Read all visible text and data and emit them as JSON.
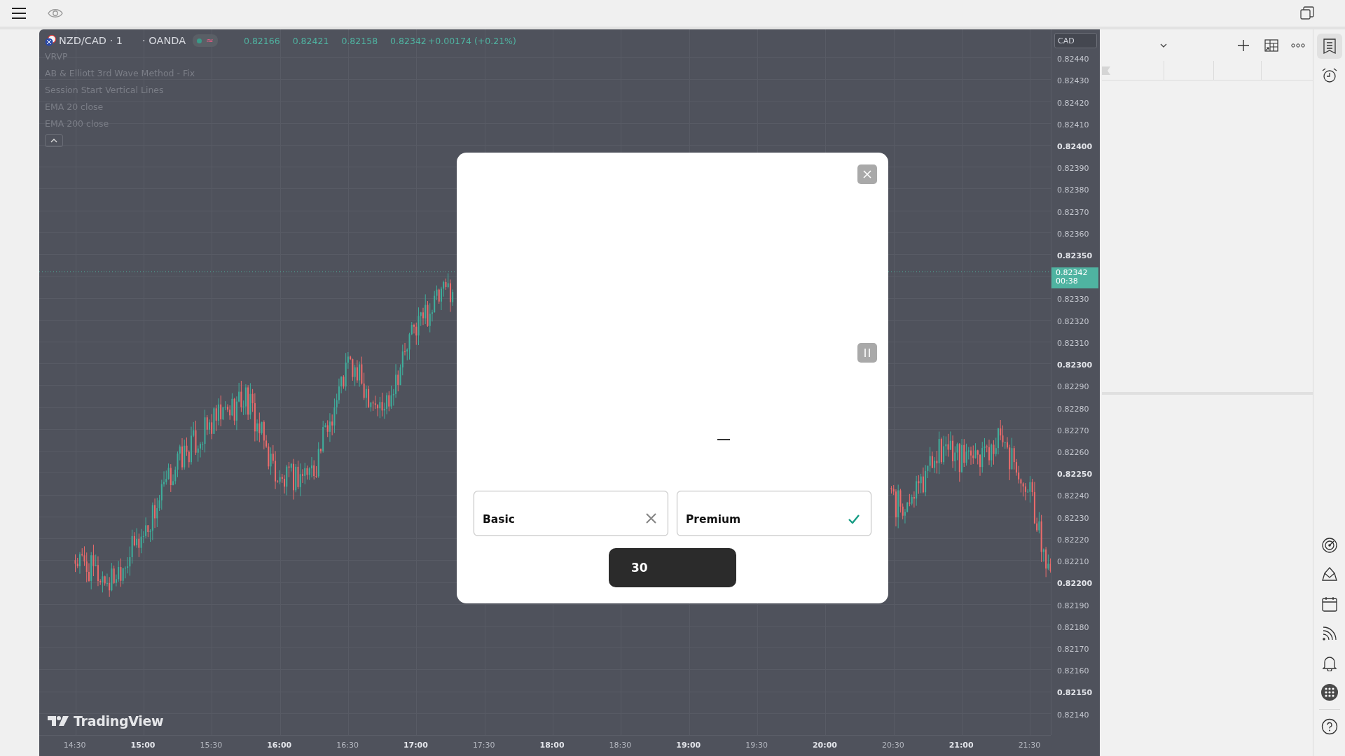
{
  "chart": {
    "symbol": "NZD/CAD · 1",
    "exchange": "· OANDA",
    "market_open": true,
    "status_symbol": "≈",
    "ohlc": [
      "0.82166",
      "0.82421",
      "0.82158",
      "0.82342"
    ],
    "change": "+0.00174 (+0.21%)",
    "indicators": [
      "VRVP",
      "AB & Elliott 3rd Wave Method - Fix",
      "Session Start Vertical Lines",
      "EMA 20 close",
      "EMA 200 close"
    ],
    "currency": "CAD",
    "price_labels": [
      {
        "kind": "label",
        "text": "0.82440",
        "major": false
      },
      {
        "kind": "label",
        "text": "0.82430",
        "major": false
      },
      {
        "kind": "label",
        "text": "0.82420",
        "major": false
      },
      {
        "kind": "label",
        "text": "0.82410",
        "major": false
      },
      {
        "kind": "label",
        "text": "0.82400",
        "major": true
      },
      {
        "kind": "label",
        "text": "0.82390",
        "major": false
      },
      {
        "kind": "label",
        "text": "0.82380",
        "major": false
      },
      {
        "kind": "label",
        "text": "0.82370",
        "major": false
      },
      {
        "kind": "label",
        "text": "0.82360",
        "major": false
      },
      {
        "kind": "label",
        "text": "0.82350",
        "major": true
      },
      {
        "kind": "last_price",
        "price": "0.82342",
        "countdown": "00:38"
      },
      {
        "kind": "label",
        "text": "0.82330",
        "major": false
      },
      {
        "kind": "label",
        "text": "0.82320",
        "major": false
      },
      {
        "kind": "label",
        "text": "0.82310",
        "major": false
      },
      {
        "kind": "label",
        "text": "0.82300",
        "major": true
      },
      {
        "kind": "label",
        "text": "0.82290",
        "major": false
      },
      {
        "kind": "label",
        "text": "0.82280",
        "major": false
      },
      {
        "kind": "label",
        "text": "0.82270",
        "major": false
      },
      {
        "kind": "label",
        "text": "0.82260",
        "major": false
      },
      {
        "kind": "label",
        "text": "0.82250",
        "major": true
      },
      {
        "kind": "label",
        "text": "0.82240",
        "major": false
      },
      {
        "kind": "label",
        "text": "0.82230",
        "major": false
      },
      {
        "kind": "label",
        "text": "0.82220",
        "major": false
      },
      {
        "kind": "label",
        "text": "0.82210",
        "major": false
      },
      {
        "kind": "label",
        "text": "0.82200",
        "major": true
      },
      {
        "kind": "label",
        "text": "0.82190",
        "major": false
      },
      {
        "kind": "label",
        "text": "0.82180",
        "major": false
      },
      {
        "kind": "label",
        "text": "0.82170",
        "major": false
      },
      {
        "kind": "label",
        "text": "0.82160",
        "major": false
      },
      {
        "kind": "label",
        "text": "0.82150",
        "major": true
      },
      {
        "kind": "label",
        "text": "0.82140",
        "major": false
      }
    ],
    "time_labels": [
      {
        "text": "14:30",
        "major": false
      },
      {
        "text": "15:00",
        "major": true
      },
      {
        "text": "15:30",
        "major": false
      },
      {
        "text": "16:00",
        "major": true
      },
      {
        "text": "16:30",
        "major": false
      },
      {
        "text": "17:00",
        "major": true
      },
      {
        "text": "17:30",
        "major": false
      },
      {
        "text": "18:00",
        "major": true
      },
      {
        "text": "18:30",
        "major": false
      },
      {
        "text": "19:00",
        "major": true
      },
      {
        "text": "19:30",
        "major": false
      },
      {
        "text": "20:00",
        "major": true
      },
      {
        "text": "20:30",
        "major": false
      },
      {
        "text": "21:00",
        "major": true
      },
      {
        "text": "21:30",
        "major": false
      }
    ],
    "logo_text": "TradingView"
  },
  "dialog": {
    "plans": [
      {
        "name": "Basic",
        "included": false
      },
      {
        "name": "Premium",
        "included": true
      }
    ],
    "button": "30"
  },
  "right_toolbar": [
    {
      "kind": "watchlist",
      "selected": true
    },
    {
      "kind": "alarm",
      "selected": false
    },
    {
      "kind": "target",
      "selected": false
    },
    {
      "kind": "ideas",
      "selected": false
    },
    {
      "kind": "calendar",
      "selected": false
    },
    {
      "kind": "stream",
      "selected": false
    },
    {
      "kind": "bell",
      "selected": false
    },
    {
      "kind": "apps",
      "selected": false
    },
    {
      "kind": "help",
      "selected": false
    }
  ]
}
